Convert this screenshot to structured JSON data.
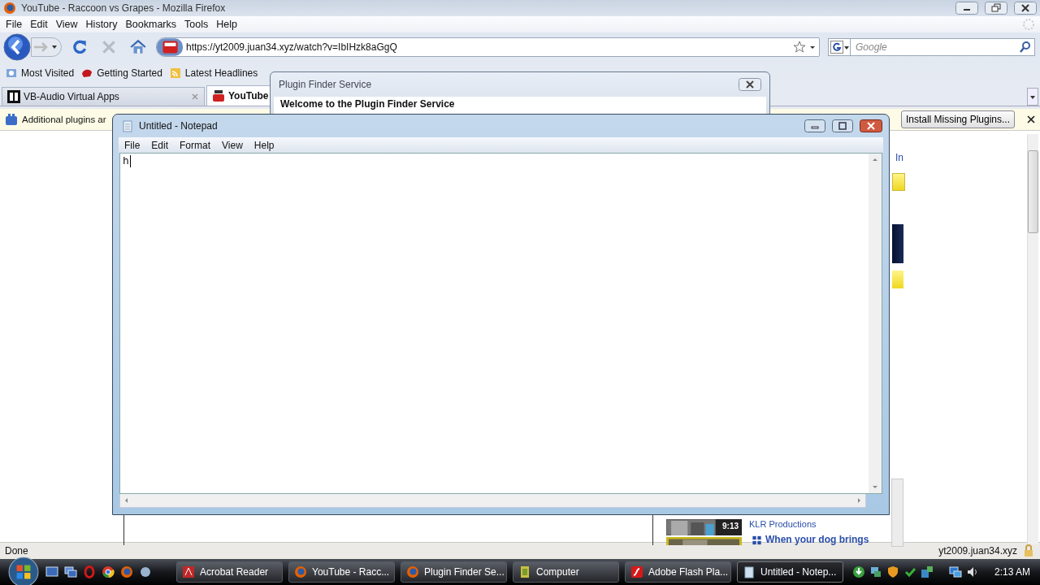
{
  "browser": {
    "title": "YouTube - Raccoon vs Grapes - Mozilla Firefox",
    "menu": [
      "File",
      "Edit",
      "View",
      "History",
      "Bookmarks",
      "Tools",
      "Help"
    ],
    "address": "https://yt2009.juan34.xyz/watch?v=IbIHzk8aGgQ",
    "search_placeholder": "Google",
    "bookmarks": [
      {
        "label": "Most Visited",
        "kind": "visited"
      },
      {
        "label": "Getting Started",
        "kind": "start"
      },
      {
        "label": "Latest Headlines",
        "kind": "feed"
      }
    ],
    "tabs": [
      {
        "label": "VB-Audio Virtual Apps",
        "selected": false,
        "kind": "vb"
      },
      {
        "label": "YouTube",
        "selected": true,
        "kind": "youtube"
      }
    ],
    "notification": {
      "text": "Additional plugins ar",
      "button": "Install Missing Plugins..."
    },
    "page": {
      "link": "In",
      "duration": "9:13",
      "channel": "KLR Productions",
      "next_title": "When your dog brings"
    },
    "status": {
      "text": "Done",
      "host": "yt2009.juan34.xyz"
    }
  },
  "plugin_dialog": {
    "title": "Plugin Finder Service",
    "heading": "Welcome to the Plugin Finder Service"
  },
  "notepad": {
    "title": "Untitled - Notepad",
    "menu": [
      "File",
      "Edit",
      "Format",
      "View",
      "Help"
    ],
    "text": "h"
  },
  "taskbar": {
    "buttons": [
      {
        "label": "Acrobat Reader",
        "kind": "pdf",
        "selected": false
      },
      {
        "label": "YouTube - Racc...",
        "kind": "firefox",
        "selected": false
      },
      {
        "label": "Plugin Finder Se...",
        "kind": "firefox",
        "selected": false
      },
      {
        "label": "Computer",
        "kind": "folder",
        "selected": false
      },
      {
        "label": "Adobe Flash Pla...",
        "kind": "flash",
        "selected": false
      },
      {
        "label": "Untitled - Notep...",
        "kind": "notepad",
        "selected": true
      }
    ],
    "clock": "2:13 AM"
  }
}
